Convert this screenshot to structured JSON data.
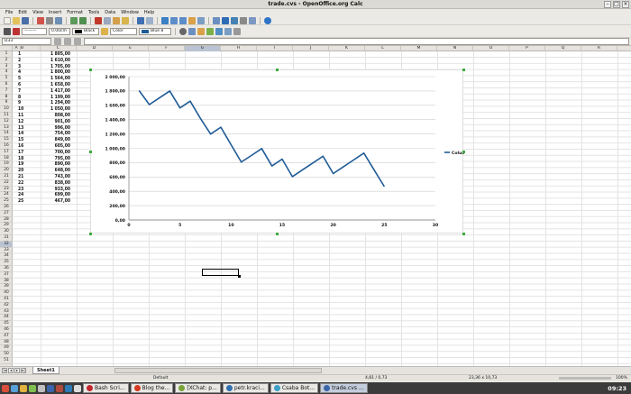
{
  "window": {
    "title": "trade.cvs - OpenOffice.org Calc"
  },
  "menu": [
    "File",
    "Edit",
    "View",
    "Insert",
    "Format",
    "Tools",
    "Data",
    "Window",
    "Help"
  ],
  "formatting": {
    "line_width": "0.00cm",
    "line_color": "Black",
    "area_mode": "Color",
    "area_color": "Blue 8"
  },
  "name_box": "D33",
  "columns": [
    "A",
    "B",
    "C",
    "D",
    "E",
    "F",
    "G",
    "H",
    "I",
    "J",
    "K",
    "L",
    "M",
    "N",
    "O",
    "P",
    "Q",
    "R"
  ],
  "selected_column": "G",
  "selected_row": 32,
  "row_count": 51,
  "data_rows": [
    {
      "n": "1",
      "v": "1 805,00"
    },
    {
      "n": "2",
      "v": "1 610,00"
    },
    {
      "n": "3",
      "v": "1 705,00"
    },
    {
      "n": "4",
      "v": "1 800,00"
    },
    {
      "n": "5",
      "v": "1 564,00"
    },
    {
      "n": "6",
      "v": "1 658,00"
    },
    {
      "n": "7",
      "v": "1 417,00"
    },
    {
      "n": "8",
      "v": "1 199,00"
    },
    {
      "n": "9",
      "v": "1 294,00"
    },
    {
      "n": "10",
      "v": "1 050,00"
    },
    {
      "n": "11",
      "v": "808,00"
    },
    {
      "n": "12",
      "v": "901,00"
    },
    {
      "n": "13",
      "v": "996,00"
    },
    {
      "n": "14",
      "v": "754,00"
    },
    {
      "n": "15",
      "v": "849,00"
    },
    {
      "n": "16",
      "v": "605,00"
    },
    {
      "n": "17",
      "v": "700,00"
    },
    {
      "n": "18",
      "v": "795,00"
    },
    {
      "n": "19",
      "v": "890,00"
    },
    {
      "n": "20",
      "v": "648,00"
    },
    {
      "n": "21",
      "v": "743,00"
    },
    {
      "n": "22",
      "v": "838,00"
    },
    {
      "n": "23",
      "v": "933,00"
    },
    {
      "n": "24",
      "v": "699,00"
    },
    {
      "n": "25",
      "v": "467,00"
    }
  ],
  "chart_data": {
    "type": "line",
    "x": [
      1,
      2,
      3,
      4,
      5,
      6,
      7,
      8,
      9,
      10,
      11,
      12,
      13,
      14,
      15,
      16,
      17,
      18,
      19,
      20,
      21,
      22,
      23,
      24,
      25
    ],
    "series": [
      {
        "name": "Column B",
        "color": "#1f5b96",
        "values": [
          1805,
          1610,
          1705,
          1800,
          1564,
          1658,
          1417,
          1199,
          1294,
          1050,
          808,
          901,
          996,
          754,
          849,
          605,
          700,
          795,
          890,
          648,
          743,
          838,
          933,
          699,
          467
        ]
      }
    ],
    "xlim": [
      0,
      30
    ],
    "ylim": [
      0,
      2000
    ],
    "x_ticks": [
      0,
      5,
      10,
      15,
      20,
      25,
      30
    ],
    "y_ticks": [
      "0,00",
      "200,00",
      "400,00",
      "600,00",
      "800,00",
      "1 000,00",
      "1 200,00",
      "1 400,00",
      "1 600,00",
      "1 800,00",
      "2 000,00"
    ],
    "grid": "horizontal",
    "legend": "right"
  },
  "sheet_tabs": [
    "Sheet1"
  ],
  "status": {
    "page_style": "Default",
    "position": "4,81 / 0,73",
    "size": "23,36 x 10,73",
    "zoom": "100%"
  },
  "taskbar": {
    "items": [
      {
        "label": "Bash Scri...",
        "color": "#c0262b"
      },
      {
        "label": "Blog the...",
        "color": "#d33a1f"
      },
      {
        "label": "[XChat: p...",
        "color": "#7aa33a"
      },
      {
        "label": "petr.kraci...",
        "color": "#2f6fb0"
      },
      {
        "label": "Csaba Bot...",
        "color": "#3aa0c8"
      },
      {
        "label": "trade.cvs ...",
        "color": "#3c64a8"
      }
    ],
    "clock": "09:23"
  }
}
